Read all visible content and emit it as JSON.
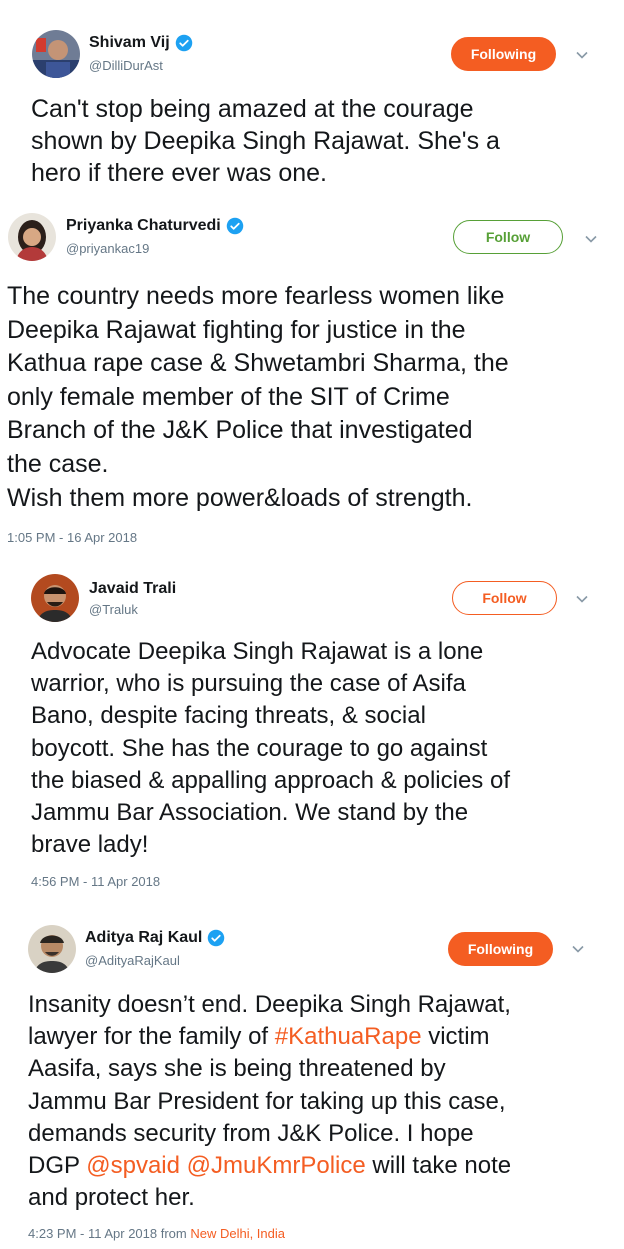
{
  "colors": {
    "accent_orange": "#f45d22",
    "follow_green": "#57a037",
    "verified_blue": "#1da1f2",
    "text": "#14171a",
    "muted": "#657786"
  },
  "tweets": [
    {
      "name": "Shivam Vij",
      "handle": "@DilliDurAst",
      "verified": true,
      "button": "Following",
      "text": "Can't stop being amazed at the courage\nshown by Deepika Singh Rajawat. She's a\nhero if there ever was one."
    },
    {
      "name": "Priyanka Chaturvedi",
      "handle": "@priyankac19",
      "verified": true,
      "button": "Follow",
      "text": "The country needs more fearless women like\nDeepika Rajawat fighting for justice in the\nKathua rape case & Shwetambri Sharma, the\nonly female member of the SIT of Crime\nBranch of the J&K Police that investigated\nthe case.\nWish them more power&loads of strength.",
      "timestamp": "1:05 PM - 16 Apr 2018"
    },
    {
      "name": "Javaid Trali",
      "handle": "@Traluk",
      "verified": false,
      "button": "Follow",
      "text": "Advocate Deepika Singh Rajawat is a lone\nwarrior, who is pursuing the case of Asifa\nBano, despite facing threats, & social\nboycott. She has the courage to go against\nthe biased & appalling approach & policies of\nJammu Bar Association. We stand by the\nbrave lady!",
      "timestamp": "4:56 PM - 11 Apr 2018"
    },
    {
      "name": "Aditya Raj Kaul",
      "handle": "@AdityaRajKaul",
      "verified": true,
      "button": "Following",
      "text_parts": {
        "p1": "Insanity doesn’t end. Deepika Singh Rajawat,\nlawyer for the family of ",
        "hashtag": "#KathuaRape",
        "p2": " victim\nAasifa, says she is being threatened by\nJammu Bar President for taking up this case,\ndemands security from J&K Police. I hope\nDGP ",
        "mention1": "@spvaid",
        "p3": " ",
        "mention2": "@JmuKmrPolice",
        "p4": " will take note\nand protect her."
      },
      "timestamp": "4:23 PM - 11 Apr 2018 from ",
      "location": "New Delhi, India"
    }
  ]
}
